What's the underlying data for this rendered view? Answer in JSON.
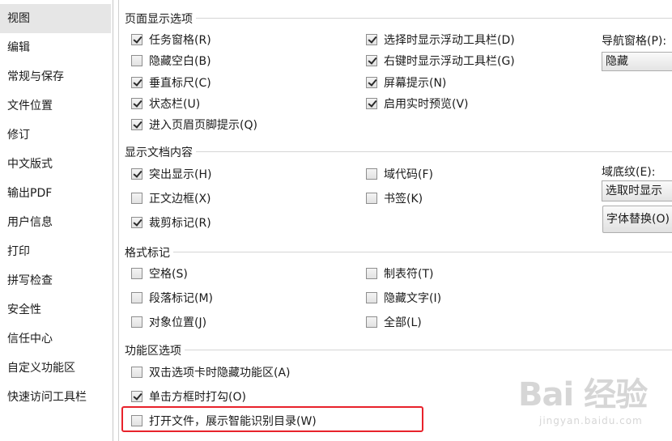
{
  "sidebar": {
    "items": [
      {
        "label": "视图"
      },
      {
        "label": "编辑"
      },
      {
        "label": "常规与保存"
      },
      {
        "label": "文件位置"
      },
      {
        "label": "修订"
      },
      {
        "label": "中文版式"
      },
      {
        "label": "输出PDF"
      },
      {
        "label": "用户信息"
      },
      {
        "label": "打印"
      },
      {
        "label": "拼写检查"
      },
      {
        "label": "安全性"
      },
      {
        "label": "信任中心"
      },
      {
        "label": "自定义功能区"
      },
      {
        "label": "快速访问工具栏"
      }
    ]
  },
  "sections": {
    "page_display": {
      "title": "页面显示选项",
      "options": [
        {
          "label": "任务窗格(R)",
          "checked": true
        },
        {
          "label": "隐藏空白(B)",
          "checked": false
        },
        {
          "label": "垂直标尺(C)",
          "checked": true
        },
        {
          "label": "状态栏(U)",
          "checked": true
        },
        {
          "label": "进入页眉页脚提示(Q)",
          "checked": true
        },
        {
          "label": "选择时显示浮动工具栏(D)",
          "checked": true
        },
        {
          "label": "右键时显示浮动工具栏(G)",
          "checked": true
        },
        {
          "label": "屏幕提示(N)",
          "checked": true
        },
        {
          "label": "启用实时预览(V)",
          "checked": true
        }
      ],
      "nav_pane_label": "导航窗格(P):",
      "nav_pane_value": "隐藏"
    },
    "doc_content": {
      "title": "显示文档内容",
      "options": [
        {
          "label": "突出显示(H)",
          "checked": true
        },
        {
          "label": "正文边框(X)",
          "checked": false
        },
        {
          "label": "裁剪标记(R)",
          "checked": true
        },
        {
          "label": "域代码(F)",
          "checked": false
        },
        {
          "label": "书签(K)",
          "checked": false
        }
      ],
      "field_shading_label": "域底纹(E):",
      "field_shading_value": "选取时显示",
      "font_sub_button": "字体替换(O)"
    },
    "format_marks": {
      "title": "格式标记",
      "options": [
        {
          "label": "空格(S)",
          "checked": false
        },
        {
          "label": "段落标记(M)",
          "checked": false
        },
        {
          "label": "对象位置(J)",
          "checked": false
        },
        {
          "label": "制表符(T)",
          "checked": false
        },
        {
          "label": "隐藏文字(I)",
          "checked": false
        },
        {
          "label": "全部(L)",
          "checked": false
        }
      ]
    },
    "ribbon": {
      "title": "功能区选项",
      "options": [
        {
          "label": "双击选项卡时隐藏功能区(A)",
          "checked": false
        },
        {
          "label": "单击方框时打勾(O)",
          "checked": true
        },
        {
          "label": "打开文件，展示智能识别目录(W)",
          "checked": false
        }
      ]
    }
  },
  "watermark": {
    "logo": "Bai 经验",
    "sub": "jingyan.baidu.com"
  },
  "colors": {
    "highlight": "#e8222b",
    "sidebar_active": "#e6e6e6"
  }
}
